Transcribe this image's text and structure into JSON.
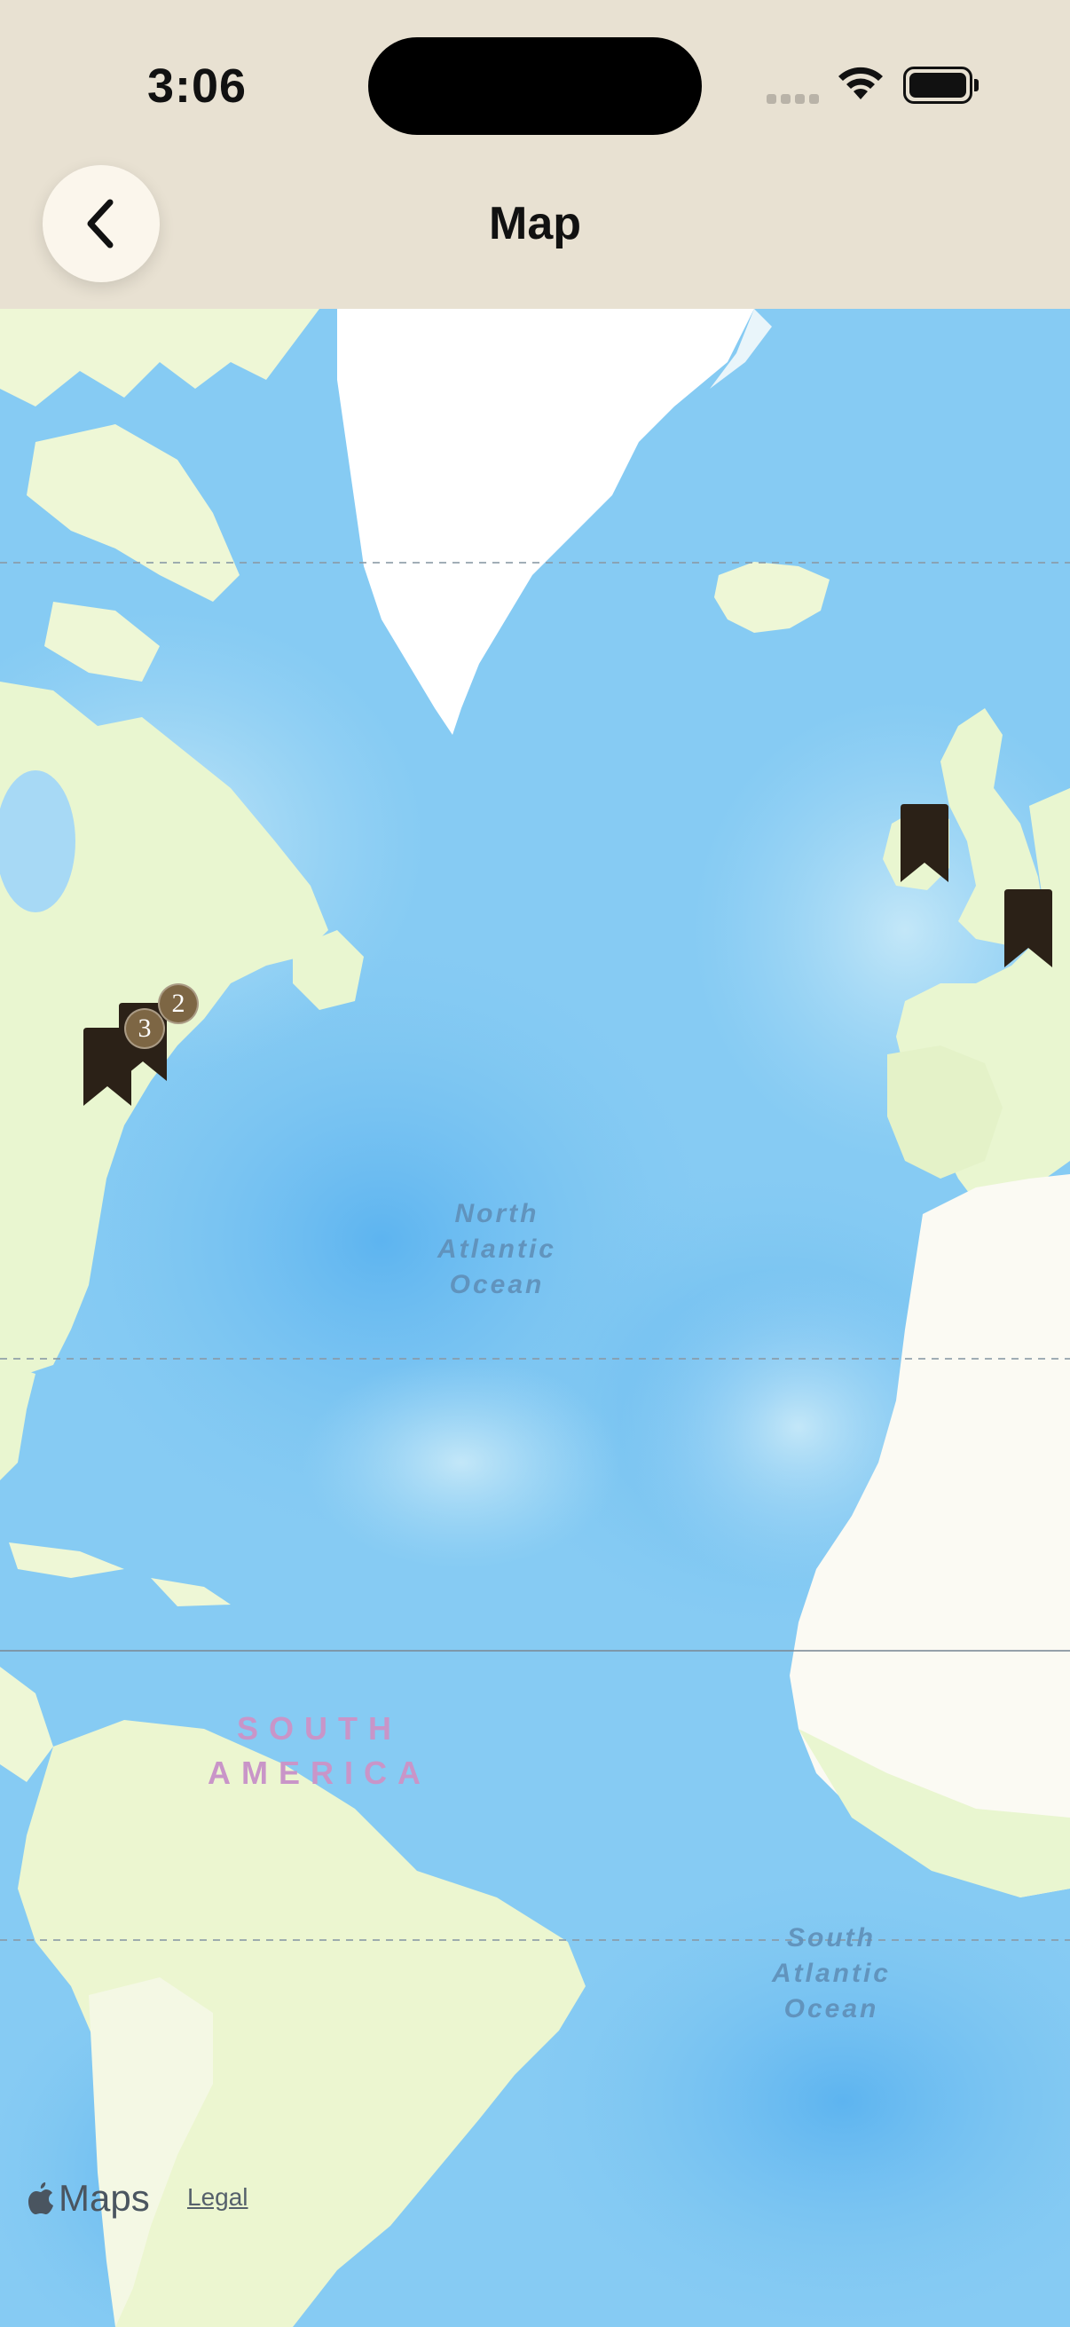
{
  "status": {
    "time": "3:06",
    "wifi_icon": "wifi-icon",
    "battery_icon": "battery-icon"
  },
  "nav": {
    "back_icon": "chevron-left-icon",
    "title": "Map"
  },
  "map": {
    "labels": {
      "north_atlantic": [
        "North",
        "Atlantic",
        "Ocean"
      ],
      "south_atlantic": [
        "South",
        "Atlantic",
        "Ocean"
      ],
      "south_america": [
        "SOUTH",
        "AMERICA"
      ]
    },
    "pins": [
      {
        "name": "bookmark-pin-cluster-3",
        "count": "3"
      },
      {
        "name": "bookmark-pin-cluster-2",
        "count": "2"
      },
      {
        "name": "bookmark-pin-ireland",
        "count": ""
      },
      {
        "name": "bookmark-pin-england",
        "count": ""
      }
    ],
    "pin_color": "#2b2117",
    "badge_color": "#7d6644",
    "attribution": {
      "brand": "Maps",
      "legal": "Legal"
    }
  }
}
